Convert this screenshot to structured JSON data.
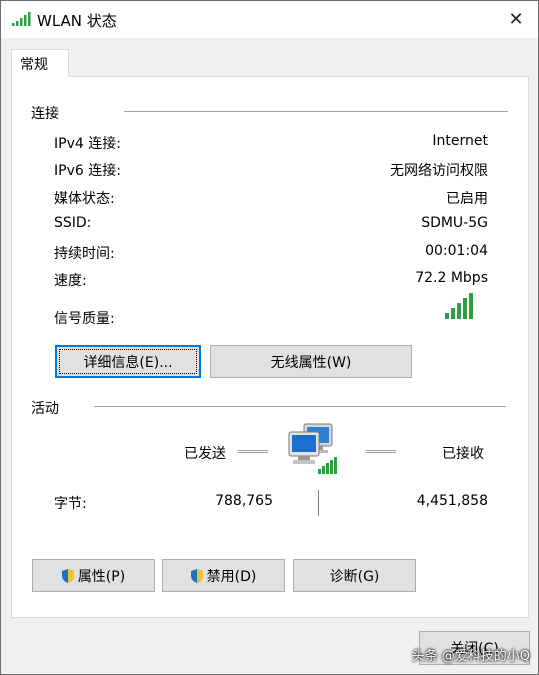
{
  "window": {
    "title": "WLAN 状态",
    "close_glyph": "✕"
  },
  "tabs": [
    {
      "label": "常规"
    }
  ],
  "connection": {
    "header": "连接",
    "rows": [
      {
        "label": "IPv4 连接:",
        "value": "Internet"
      },
      {
        "label": "IPv6 连接:",
        "value": "无网络访问权限"
      },
      {
        "label": "媒体状态:",
        "value": "已启用"
      },
      {
        "label": "SSID:",
        "value": "SDMU-5G"
      },
      {
        "label": "持续时间:",
        "value": "00:01:04"
      },
      {
        "label": "速度:",
        "value": "72.2 Mbps"
      }
    ],
    "signal_label": "信号质量:",
    "signal_bars": 5,
    "details_button": "详细信息(E)...",
    "wireless_props_button": "无线属性(W)"
  },
  "activity": {
    "header": "活动",
    "sent_label": "已发送",
    "received_label": "已接收",
    "bytes_label": "字节:",
    "bytes_sent": "788,765",
    "bytes_received": "4,451,858"
  },
  "actions": {
    "properties_button": "属性(P)",
    "disable_button": "禁用(D)",
    "diagnose_button": "诊断(G)"
  },
  "footer": {
    "close_button": "关闭(C)"
  },
  "watermark": "头条 @爱科技的小Q",
  "colors": {
    "signal_green": "#2ea043",
    "accent_blue": "#0078d7",
    "shield_blue": "#1e73be"
  }
}
